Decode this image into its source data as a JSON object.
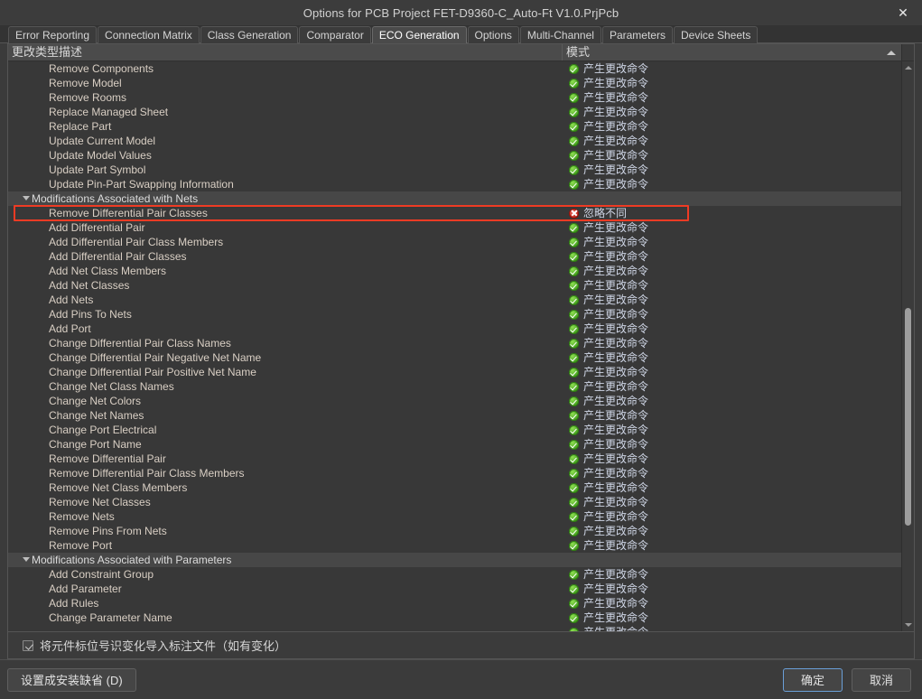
{
  "window": {
    "title": "Options for PCB Project FET-D9360-C_Auto-Ft  V1.0.PrjPcb",
    "close_label": "✕"
  },
  "tabs": [
    {
      "label": "Error Reporting",
      "active": false
    },
    {
      "label": "Connection Matrix",
      "active": false
    },
    {
      "label": "Class Generation",
      "active": false
    },
    {
      "label": "Comparator",
      "active": false
    },
    {
      "label": "ECO Generation",
      "active": true
    },
    {
      "label": "Options",
      "active": false
    },
    {
      "label": "Multi-Channel",
      "active": false
    },
    {
      "label": "Parameters",
      "active": false
    },
    {
      "label": "Device Sheets",
      "active": false
    }
  ],
  "grid": {
    "columns": {
      "description": "更改类型描述",
      "mode": "模式"
    },
    "mode_values": {
      "generate": "产生更改命令",
      "ignore": "忽略不同"
    },
    "rows": [
      {
        "label": "Remove Components",
        "mode": "产生更改命令",
        "icon": "check-green-icon",
        "type": "item"
      },
      {
        "label": "Remove Model",
        "mode": "产生更改命令",
        "icon": "check-green-icon",
        "type": "item"
      },
      {
        "label": "Remove Rooms",
        "mode": "产生更改命令",
        "icon": "check-green-icon",
        "type": "item"
      },
      {
        "label": "Replace Managed Sheet",
        "mode": "产生更改命令",
        "icon": "check-green-icon",
        "type": "item"
      },
      {
        "label": "Replace Part",
        "mode": "产生更改命令",
        "icon": "check-green-icon",
        "type": "item"
      },
      {
        "label": "Update Current Model",
        "mode": "产生更改命令",
        "icon": "check-green-icon",
        "type": "item"
      },
      {
        "label": "Update Model Values",
        "mode": "产生更改命令",
        "icon": "check-green-icon",
        "type": "item"
      },
      {
        "label": "Update Part Symbol",
        "mode": "产生更改命令",
        "icon": "check-green-icon",
        "type": "item"
      },
      {
        "label": "Update Pin-Part Swapping Information",
        "mode": "产生更改命令",
        "icon": "check-green-icon",
        "type": "item"
      },
      {
        "label": "Modifications Associated with Nets",
        "mode": "",
        "icon": "",
        "type": "group"
      },
      {
        "label": "Remove Differential Pair Classes",
        "mode": "忽略不同",
        "icon": "cross-red-icon",
        "type": "item",
        "highlighted": true
      },
      {
        "label": "Add Differential Pair",
        "mode": "产生更改命令",
        "icon": "check-green-icon",
        "type": "item"
      },
      {
        "label": "Add Differential Pair Class Members",
        "mode": "产生更改命令",
        "icon": "check-green-icon",
        "type": "item"
      },
      {
        "label": "Add Differential Pair Classes",
        "mode": "产生更改命令",
        "icon": "check-green-icon",
        "type": "item"
      },
      {
        "label": "Add Net Class Members",
        "mode": "产生更改命令",
        "icon": "check-green-icon",
        "type": "item"
      },
      {
        "label": "Add Net Classes",
        "mode": "产生更改命令",
        "icon": "check-green-icon",
        "type": "item"
      },
      {
        "label": "Add Nets",
        "mode": "产生更改命令",
        "icon": "check-green-icon",
        "type": "item"
      },
      {
        "label": "Add Pins To Nets",
        "mode": "产生更改命令",
        "icon": "check-green-icon",
        "type": "item"
      },
      {
        "label": "Add Port",
        "mode": "产生更改命令",
        "icon": "check-green-icon",
        "type": "item"
      },
      {
        "label": "Change Differential Pair Class Names",
        "mode": "产生更改命令",
        "icon": "check-green-icon",
        "type": "item"
      },
      {
        "label": "Change Differential Pair Negative Net Name",
        "mode": "产生更改命令",
        "icon": "check-green-icon",
        "type": "item"
      },
      {
        "label": "Change Differential Pair Positive Net Name",
        "mode": "产生更改命令",
        "icon": "check-green-icon",
        "type": "item"
      },
      {
        "label": "Change Net Class Names",
        "mode": "产生更改命令",
        "icon": "check-green-icon",
        "type": "item"
      },
      {
        "label": "Change Net Colors",
        "mode": "产生更改命令",
        "icon": "check-green-icon",
        "type": "item"
      },
      {
        "label": "Change Net Names",
        "mode": "产生更改命令",
        "icon": "check-green-icon",
        "type": "item"
      },
      {
        "label": "Change Port Electrical",
        "mode": "产生更改命令",
        "icon": "check-green-icon",
        "type": "item"
      },
      {
        "label": "Change Port Name",
        "mode": "产生更改命令",
        "icon": "check-green-icon",
        "type": "item"
      },
      {
        "label": "Remove Differential Pair",
        "mode": "产生更改命令",
        "icon": "check-green-icon",
        "type": "item"
      },
      {
        "label": "Remove Differential Pair Class Members",
        "mode": "产生更改命令",
        "icon": "check-green-icon",
        "type": "item"
      },
      {
        "label": "Remove Net Class Members",
        "mode": "产生更改命令",
        "icon": "check-green-icon",
        "type": "item"
      },
      {
        "label": "Remove Net Classes",
        "mode": "产生更改命令",
        "icon": "check-green-icon",
        "type": "item"
      },
      {
        "label": "Remove Nets",
        "mode": "产生更改命令",
        "icon": "check-green-icon",
        "type": "item"
      },
      {
        "label": "Remove Pins From Nets",
        "mode": "产生更改命令",
        "icon": "check-green-icon",
        "type": "item"
      },
      {
        "label": "Remove Port",
        "mode": "产生更改命令",
        "icon": "check-green-icon",
        "type": "item"
      },
      {
        "label": "Modifications Associated with Parameters",
        "mode": "",
        "icon": "",
        "type": "group"
      },
      {
        "label": "Add Constraint Group",
        "mode": "产生更改命令",
        "icon": "check-green-icon",
        "type": "item"
      },
      {
        "label": "Add Parameter",
        "mode": "产生更改命令",
        "icon": "check-green-icon",
        "type": "item"
      },
      {
        "label": "Add Rules",
        "mode": "产生更改命令",
        "icon": "check-green-icon",
        "type": "item"
      },
      {
        "label": "Change Parameter Name",
        "mode": "产生更改命令",
        "icon": "check-green-icon",
        "type": "item"
      },
      {
        "label": "",
        "mode": "产生更改命令",
        "icon": "check-green-icon",
        "type": "item",
        "partial": true
      }
    ]
  },
  "options": {
    "annotate_checkbox_label": "将元件标位号识变化导入标注文件（如有变化）",
    "annotate_checked": true
  },
  "footer": {
    "set_defaults": "设置成安装缺省 (D)",
    "ok": "确定",
    "cancel": "取消"
  },
  "colors": {
    "highlight_box": "#ef3b24",
    "ok_icon": "#4aa81b",
    "ignore_icon": "#c62a18",
    "accent_focus": "#6a9fd8"
  }
}
